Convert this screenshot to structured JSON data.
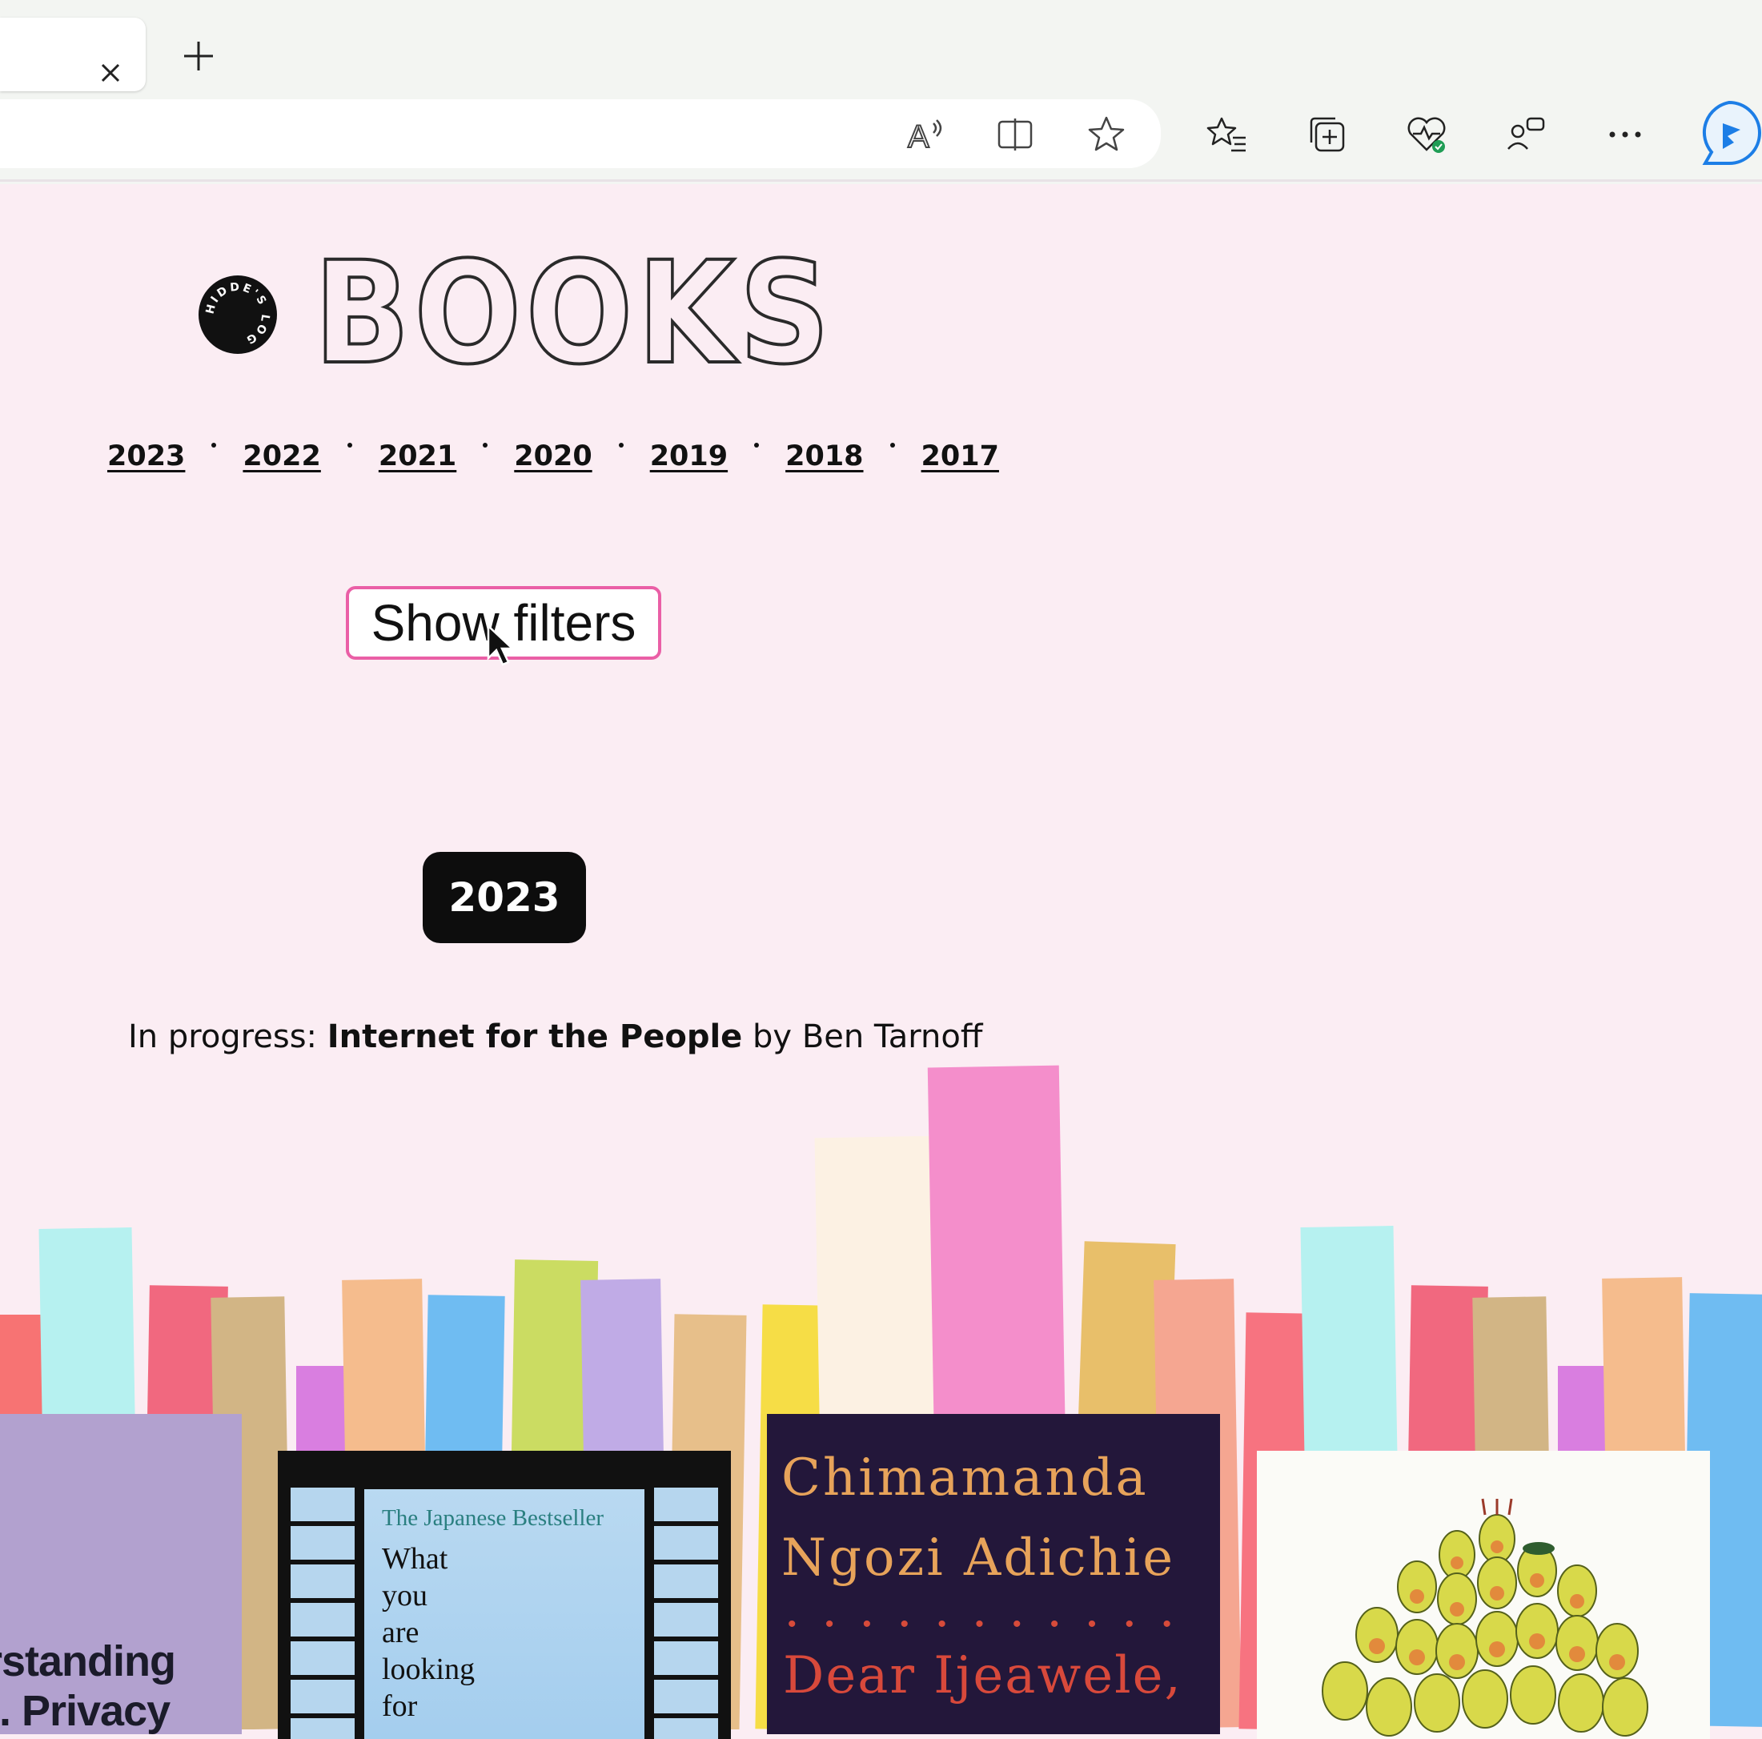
{
  "browser": {
    "tab_close_label": "×",
    "new_tab_label": "+",
    "toolbar_icons": [
      "read-aloud-icon",
      "split-screen-icon",
      "add-favorite-icon",
      "favorites-icon",
      "collections-icon",
      "browser-essentials-icon",
      "feedback-icon",
      "more-icon",
      "bing-chat-icon"
    ]
  },
  "site": {
    "title": "BOOKS",
    "logo_text": "HIDDE'S LOG"
  },
  "year_nav": [
    "2023",
    "2022",
    "2021",
    "2020",
    "2019",
    "2018",
    "2017"
  ],
  "filters_button": {
    "label": "Show filters"
  },
  "section": {
    "year": "2023"
  },
  "in_progress": {
    "prefix": "In progress: ",
    "book_title": "Internet for the People",
    "by": " by ",
    "author": "Ben Tarnoff"
  },
  "covers": [
    {
      "name": "privacy",
      "text": "rstanding\n-. Privacy"
    },
    {
      "name": "japanese",
      "subtitle": "The Japanese Bestseller",
      "title": "What\nyou\nare\nlooking\nfor"
    },
    {
      "name": "adichie",
      "author": "Chimamanda\nNgozi Adichie",
      "title": "Dear Ijeawele,"
    },
    {
      "name": "avocado"
    }
  ],
  "colors": {
    "page_bg": "#fbedf3",
    "accent_pink": "#ea5fa6",
    "badge_bg": "#0d0d0d"
  }
}
